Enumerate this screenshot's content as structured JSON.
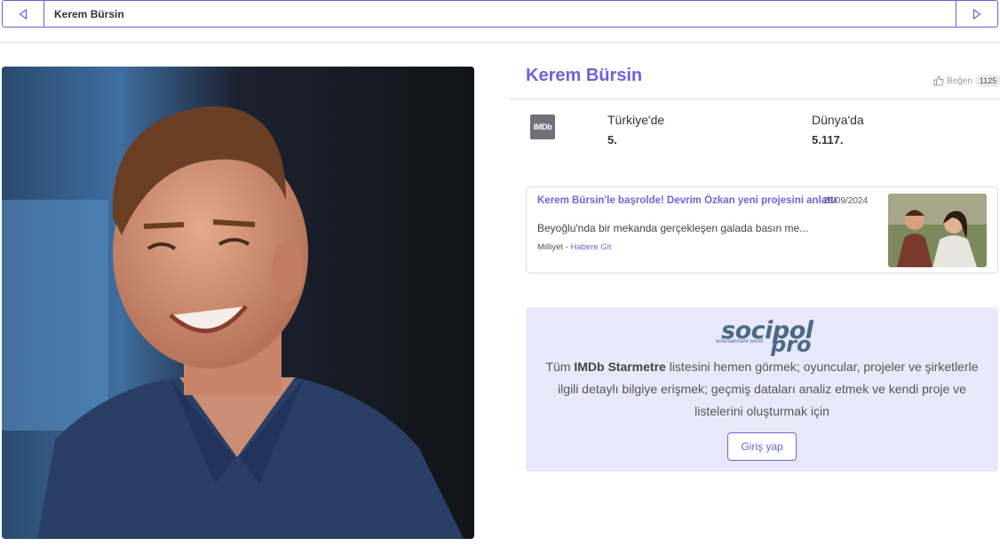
{
  "header": {
    "title": "Kerem Bürsin",
    "prev_icon": "triangle-left-icon",
    "next_icon": "triangle-right-icon"
  },
  "profile": {
    "name": "Kerem Bürsin",
    "like_label": "Beğen",
    "like_count": "1125"
  },
  "ranking": {
    "logo_text": "IMDb",
    "turkey_label": "Türkiye'de",
    "turkey_value": "5.",
    "world_label": "Dünya'da",
    "world_value": "5.117."
  },
  "news": {
    "title": "Kerem Bürsin'le başrolde! Devrim Özkan yeni projesini anlattı",
    "date": "28/09/2024",
    "snippet": "Beyoğlu'nda bir mekanda gerçekleşen galada basın me...",
    "source": "Milliyet - ",
    "link": "Habere Git"
  },
  "promo": {
    "brand_main": "socipol",
    "brand_sub": "entertainment world",
    "brand_pro": "pro",
    "text_pre": "Tüm ",
    "text_bold": "IMDb Starmetre",
    "text_post": " listesini hemen görmek; oyuncular, projeler ve şirketlerle ilgili detaylı bilgiye erişmek; geçmiş dataları analiz etmek ve kendi proje ve listelerini oluşturmak için",
    "login_label": "Giriş yap"
  },
  "colors": {
    "accent": "#6c63e0",
    "promo_bg": "#e8e8fa",
    "border": "#6b63d9"
  }
}
